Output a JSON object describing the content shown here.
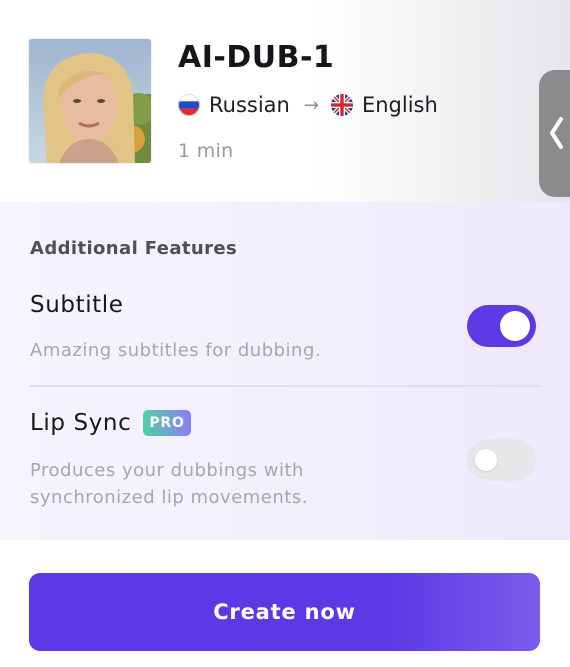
{
  "project": {
    "title": "AI-DUB-1",
    "source_language": "Russian",
    "target_language": "English",
    "duration": "1 min"
  },
  "features": {
    "section_title": "Additional Features",
    "subtitle": {
      "name": "Subtitle",
      "description": "Amazing subtitles for dubbing.",
      "enabled": true
    },
    "lip_sync": {
      "name": "Lip Sync",
      "badge": "PRO",
      "description_line1": "Produces your dubbings with",
      "description_line2": "synchronized lip movements.",
      "enabled": false
    }
  },
  "cta": {
    "label": "Create now"
  },
  "colors": {
    "accent": "#5a3be6",
    "toggle_off": "#e7e7ea",
    "muted_text": "#a6a6ae"
  },
  "icons": {
    "source_flag": "russia-flag-icon",
    "target_flag": "uk-flag-icon",
    "arrow": "arrow-right-icon",
    "side_tab": "chevron-left-icon"
  }
}
